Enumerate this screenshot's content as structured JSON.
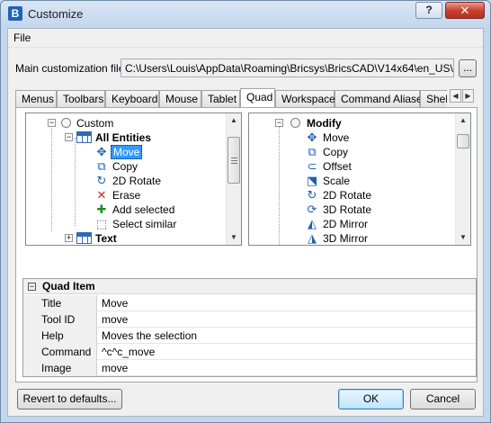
{
  "window": {
    "title": "Customize",
    "help_label": "?",
    "close_label": "✕"
  },
  "menu": {
    "items": [
      "File"
    ]
  },
  "main_file": {
    "label": "Main customization file:",
    "path": "C:\\Users\\Louis\\AppData\\Roaming\\Bricsys\\BricsCAD\\V14x64\\en_US\\Support\\",
    "browse_label": "..."
  },
  "tabs": [
    "Menus",
    "Toolbars",
    "Keyboard",
    "Mouse",
    "Tablet",
    "Quad",
    "Workspace",
    "Command Aliases",
    "Shell C"
  ],
  "active_tab": "Quad",
  "left_tree": [
    {
      "label": "Custom",
      "expander": "−",
      "icon": "radio-icon",
      "level": 0,
      "bold": false
    },
    {
      "label": "All Entities",
      "expander": "−",
      "icon": "table-icon",
      "level": 1,
      "bold": true
    },
    {
      "label": "Move",
      "icon": "move-icon",
      "level": 2,
      "selected": true
    },
    {
      "label": "Copy",
      "icon": "copy-icon",
      "level": 2
    },
    {
      "label": "2D Rotate",
      "icon": "rotate-2d-icon",
      "level": 2
    },
    {
      "label": "Erase",
      "icon": "erase-icon",
      "level": 2
    },
    {
      "label": "Add selected",
      "icon": "add-selected-icon",
      "level": 2
    },
    {
      "label": "Select similar",
      "icon": "select-similar-icon",
      "level": 2
    },
    {
      "label": "Text",
      "expander": "+",
      "icon": "table-icon",
      "level": 1,
      "bold": true
    }
  ],
  "right_tree": [
    {
      "label": "Modify",
      "expander": "−",
      "icon": "radio-icon",
      "level": 0,
      "bold": true
    },
    {
      "label": "Move",
      "icon": "move-icon",
      "level": 1
    },
    {
      "label": "Copy",
      "icon": "copy-icon",
      "level": 1
    },
    {
      "label": "Offset",
      "icon": "offset-icon",
      "level": 1
    },
    {
      "label": "Scale",
      "icon": "scale-icon",
      "level": 1
    },
    {
      "label": "2D Rotate",
      "icon": "rotate-2d-icon",
      "level": 1
    },
    {
      "label": "3D Rotate",
      "icon": "rotate-3d-icon",
      "level": 1
    },
    {
      "label": "2D Mirror",
      "icon": "mirror-2d-icon",
      "level": 1
    },
    {
      "label": "3D Mirror",
      "icon": "mirror-3d-icon",
      "level": 1
    }
  ],
  "properties": {
    "group_toggle": "−",
    "group_title": "Quad Item",
    "rows": [
      {
        "name": "Title",
        "value": "Move"
      },
      {
        "name": "Tool ID",
        "value": "move"
      },
      {
        "name": "Help",
        "value": "Moves the selection"
      },
      {
        "name": "Command",
        "value": "^c^c_move"
      },
      {
        "name": "Image",
        "value": "move"
      }
    ]
  },
  "buttons": {
    "revert": "Revert to defaults...",
    "ok": "OK",
    "cancel": "Cancel"
  },
  "colors": {
    "selection": "#3399ff",
    "close": "#c8432f",
    "accent": "#2e6bb7"
  }
}
